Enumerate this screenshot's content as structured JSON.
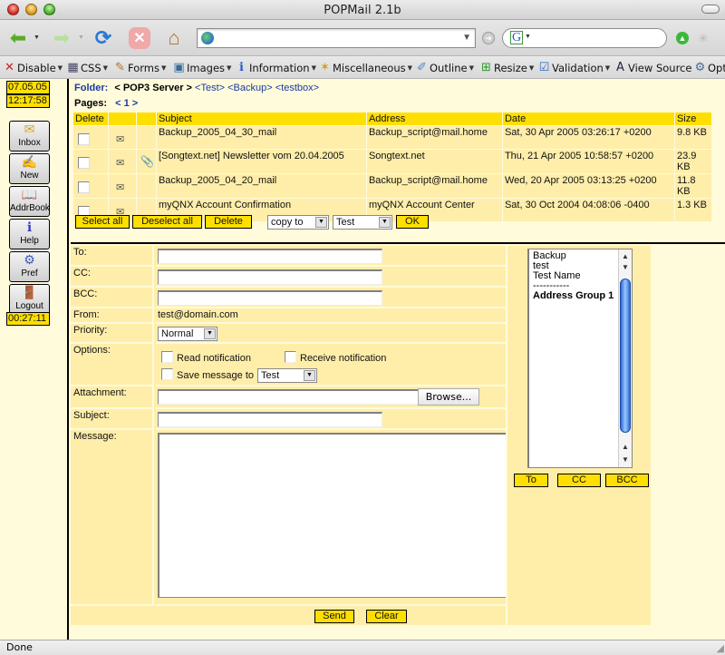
{
  "window": {
    "title": "POPMail 2.1b"
  },
  "nav": {
    "url_value": "",
    "search_value": "",
    "search_engine_icon": "G"
  },
  "devtoolbar": {
    "items": [
      {
        "label": "Disable",
        "icon": "x-icon"
      },
      {
        "label": "CSS",
        "icon": "css-icon"
      },
      {
        "label": "Forms",
        "icon": "forms-icon"
      },
      {
        "label": "Images",
        "icon": "images-icon"
      },
      {
        "label": "Information",
        "icon": "info-icon"
      },
      {
        "label": "Miscellaneous",
        "icon": "wand-icon"
      },
      {
        "label": "Outline",
        "icon": "pencil-icon"
      },
      {
        "label": "Resize",
        "icon": "resize-icon"
      },
      {
        "label": "Validation",
        "icon": "validation-icon"
      },
      {
        "label": "View Source",
        "icon": "source-icon"
      },
      {
        "label": "Opt",
        "icon": "options-icon"
      }
    ]
  },
  "sidebar": {
    "date": "07.05.05",
    "time": "12:17:58",
    "session_timer": "00:27:11",
    "buttons": [
      {
        "label": "Inbox",
        "icon": "envelope-icon"
      },
      {
        "label": "New",
        "icon": "new-message-icon"
      },
      {
        "label": "AddrBook",
        "icon": "book-icon"
      },
      {
        "label": "Help",
        "icon": "help-icon"
      },
      {
        "label": "Pref",
        "icon": "preferences-icon"
      },
      {
        "label": "Logout",
        "icon": "door-icon"
      }
    ]
  },
  "mailbox": {
    "folder_label": "Folder:",
    "current_folder": "< POP3 Server >",
    "folders": [
      "<Test>",
      "<Backup>",
      "<testbox>"
    ],
    "pages_label": "Pages:",
    "pages": "< 1 >",
    "columns": [
      "Delete",
      "",
      "",
      "Subject",
      "Address",
      "Date",
      "Size"
    ],
    "messages": [
      {
        "subject": "Backup_2005_04_30_mail",
        "address": "Backup_script@mail.home",
        "date": "Sat, 30 Apr 2005 03:26:17 +0200",
        "size": "9.8 KB",
        "attachment": false
      },
      {
        "subject": "[Songtext.net] Newsletter vom 20.04.2005",
        "address": "Songtext.net",
        "date": "Thu, 21 Apr 2005 10:58:57 +0200",
        "size": "23.9 KB",
        "attachment": true
      },
      {
        "subject": "Backup_2005_04_20_mail",
        "address": "Backup_script@mail.home",
        "date": "Wed, 20 Apr 2005 03:13:25 +0200",
        "size": "11.8 KB",
        "attachment": false
      },
      {
        "subject": "myQNX Account Confirmation",
        "address": "myQNX Account Center",
        "date": "Sat, 30 Oct 2004 04:08:06 -0400",
        "size": "1.3 KB",
        "attachment": false
      }
    ],
    "actions": {
      "select_all": "Select all",
      "deselect_all": "Deselect all",
      "delete": "Delete",
      "copy_mode": "copy to",
      "target_folder": "Test",
      "ok": "OK"
    }
  },
  "compose": {
    "labels": {
      "to": "To:",
      "cc": "CC:",
      "bcc": "BCC:",
      "from": "From:",
      "priority": "Priority:",
      "options": "Options:",
      "attachment": "Attachment:",
      "subject": "Subject:",
      "message": "Message:"
    },
    "values": {
      "to": "",
      "cc": "",
      "bcc": "",
      "from": "test@domain.com",
      "priority": "Normal",
      "attachment": "",
      "subject": "",
      "message": ""
    },
    "options": {
      "read_notification": {
        "label": "Read notification",
        "checked": false
      },
      "receive_notification": {
        "label": "Receive notification",
        "checked": false
      },
      "save_message": {
        "label": "Save message to",
        "checked": false,
        "folder": "Test"
      }
    },
    "browse_label": "Browse...",
    "send_label": "Send",
    "clear_label": "Clear",
    "address_list": [
      "Backup",
      "test",
      "Test Name",
      "-----------",
      "Address Group 1"
    ],
    "address_buttons": {
      "to": "To",
      "cc": "CC",
      "bcc": "BCC"
    }
  },
  "status": {
    "text": "Done"
  },
  "colors": {
    "accent_yellow": "#ffdf00",
    "row_bg": "#ffeeaa",
    "page_bg": "#fffbdb",
    "link_blue": "#1a3aa0"
  }
}
